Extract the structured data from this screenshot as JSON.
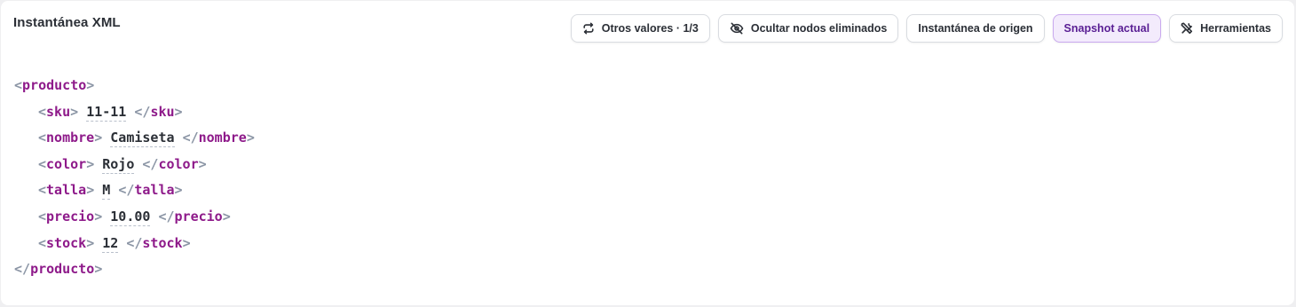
{
  "title": "Instantánea XML",
  "toolbar": {
    "other_values": "Otros valores · 1/3",
    "hide_deleted": "Ocultar nodos eliminados",
    "source_snapshot": "Instantánea de origen",
    "current_snapshot": "Snapshot actual",
    "tools": "Herramientas"
  },
  "xml": {
    "root": "producto",
    "children": [
      {
        "tag": "sku",
        "value": "11-11"
      },
      {
        "tag": "nombre",
        "value": "Camiseta"
      },
      {
        "tag": "color",
        "value": "Rojo"
      },
      {
        "tag": "talla",
        "value": "M"
      },
      {
        "tag": "precio",
        "value": "10.00"
      },
      {
        "tag": "stock",
        "value": "12"
      }
    ]
  },
  "colors": {
    "tag": "#8e1a8a",
    "bracket": "#8b95a5",
    "active_bg": "#f3ebfc",
    "active_text": "#5a1f94"
  },
  "icons": {
    "other_values": "refresh-icon",
    "hide_deleted": "eye-off-icon",
    "tools": "tools-icon"
  }
}
